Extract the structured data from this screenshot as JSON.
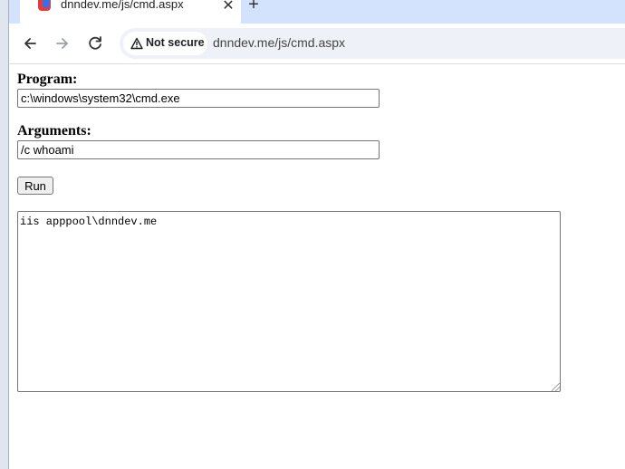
{
  "browser": {
    "tab_title": "dnndev.me/js/cmd.aspx",
    "close_glyph": "✕",
    "new_tab_glyph": "+",
    "security_chip": "Not secure",
    "url": "dnndev.me/js/cmd.aspx",
    "icons": [
      "back-arrow-icon",
      "forward-arrow-icon",
      "reload-icon",
      "warning-triangle-icon"
    ]
  },
  "form": {
    "program_label": "Program:",
    "program_value": "c:\\windows\\system32\\cmd.exe",
    "arguments_label": "Arguments:",
    "arguments_value": "/c whoami",
    "run_label": "Run",
    "output_text": "iis apppool\\dnndev.me"
  },
  "colors": {
    "tabbar": "#d3e3fd",
    "omnibox": "#eef1f8"
  }
}
